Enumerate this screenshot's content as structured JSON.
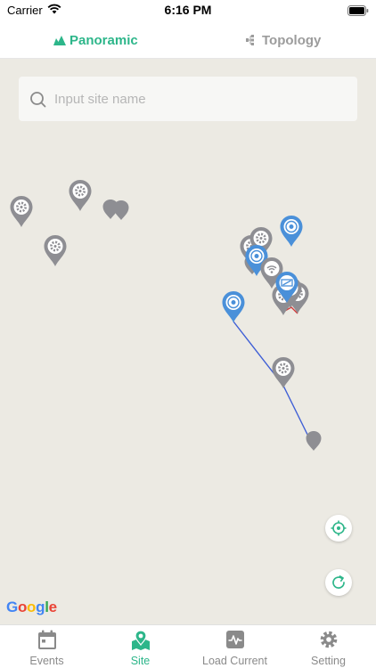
{
  "status_bar": {
    "carrier": "Carrier",
    "time": "6:16 PM"
  },
  "top_tabs": [
    {
      "label": "Panoramic",
      "icon": "panoramic-icon",
      "active": true
    },
    {
      "label": "Topology",
      "icon": "topology-icon",
      "active": false
    }
  ],
  "search": {
    "placeholder": "Input site name",
    "value": ""
  },
  "map": {
    "attribution": "Google",
    "buttons": [
      "locate-icon",
      "refresh-icon"
    ]
  },
  "bottom_tabs": [
    {
      "label": "Events",
      "icon": "calendar-icon",
      "active": false
    },
    {
      "label": "Site",
      "icon": "map-pin-icon",
      "active": true
    },
    {
      "label": "Load Current",
      "icon": "pulse-icon",
      "active": false
    },
    {
      "label": "Setting",
      "icon": "gear-icon",
      "active": false
    }
  ],
  "colors": {
    "accent": "#2db68a",
    "inactive": "#8a8a8a",
    "map_bg": "#eceae3",
    "marker_gray": "#8e8e93",
    "marker_blue": "#4a90d9",
    "route_line": "#3f5fd6"
  }
}
